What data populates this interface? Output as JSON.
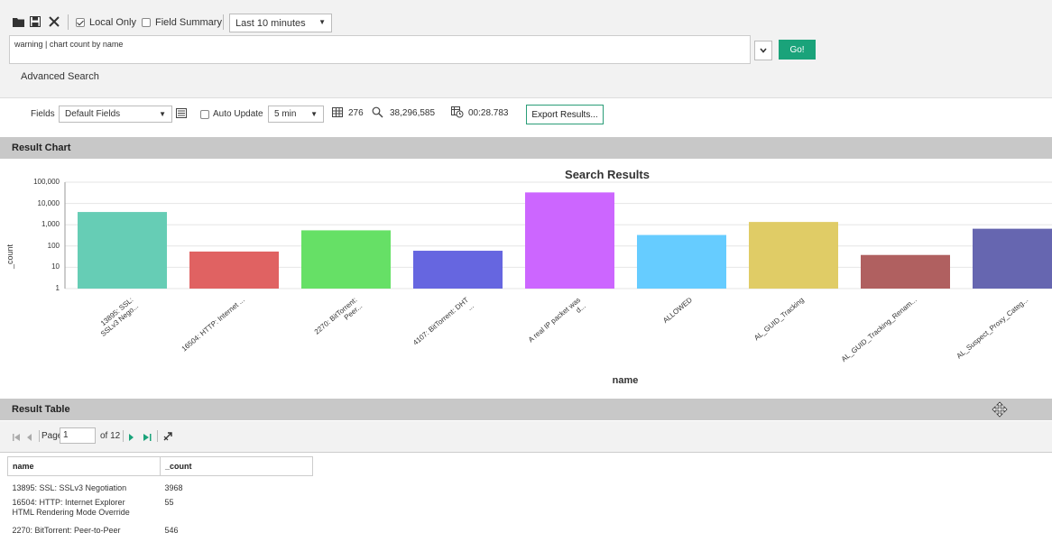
{
  "toolbar": {
    "local_only_label": "Local Only",
    "local_only_checked": true,
    "field_summary_label": "Field Summary",
    "field_summary_checked": false,
    "time_range": "Last 10 minutes"
  },
  "search": {
    "query": "warning | chart count by name",
    "go_label": "Go!",
    "advanced_label": "Advanced Search"
  },
  "fields_bar": {
    "fields_label": "Fields",
    "fields_value": "Default Fields",
    "auto_update_label": "Auto Update",
    "auto_update_interval": "5 min",
    "result_count": "276",
    "scanned_count": "38,296,585",
    "elapsed": "00:28.783",
    "export_label": "Export Results..."
  },
  "colors": {
    "go_button": "#1aa37a",
    "section_bar": "#c8c8c8",
    "export_border": "#2a9d78"
  },
  "chart_section_title": "Result Chart",
  "chart_data": {
    "type": "bar",
    "title": "Search Results",
    "xlabel": "name",
    "ylabel": "_count",
    "yscale": "log",
    "ylim": [
      1,
      100000
    ],
    "yticks": [
      "1",
      "10",
      "100",
      "1,000",
      "10,000",
      "100,000"
    ],
    "grid": true,
    "categories": [
      "13895: SSL:\nSSLv3 Nego...",
      "16504: HTTP: Internet ...",
      "2270: BitTorrent:\nPeer...",
      "4107: BitTorrent: DHT\n...",
      "A real IP packet was\nd...",
      "ALLOWED",
      "AL_GUID_Tracking",
      "AL_GUID_Tracking_Renam...",
      "AL_Suspect_Proxy_Categ..."
    ],
    "values": [
      3968,
      55,
      546,
      60,
      33000,
      330,
      1350,
      38,
      650
    ],
    "colors": [
      "#66cdb5",
      "#e06262",
      "#66e066",
      "#6666e0",
      "#cc66ff",
      "#66ccff",
      "#e0cc66",
      "#b06060",
      "#6666b0"
    ]
  },
  "table_section_title": "Result Table",
  "pager": {
    "page_label": "Page",
    "page_value": "1",
    "of_label": "of 12"
  },
  "table": {
    "columns": [
      "name",
      "_count"
    ],
    "rows": [
      [
        "13895: SSL: SSLv3 Negotiation",
        "3968"
      ],
      [
        "16504: HTTP: Internet Explorer\nHTML Rendering Mode Override",
        "55"
      ],
      [
        "2270: BitTorrent: Peer-to-Peer",
        "546"
      ]
    ]
  }
}
